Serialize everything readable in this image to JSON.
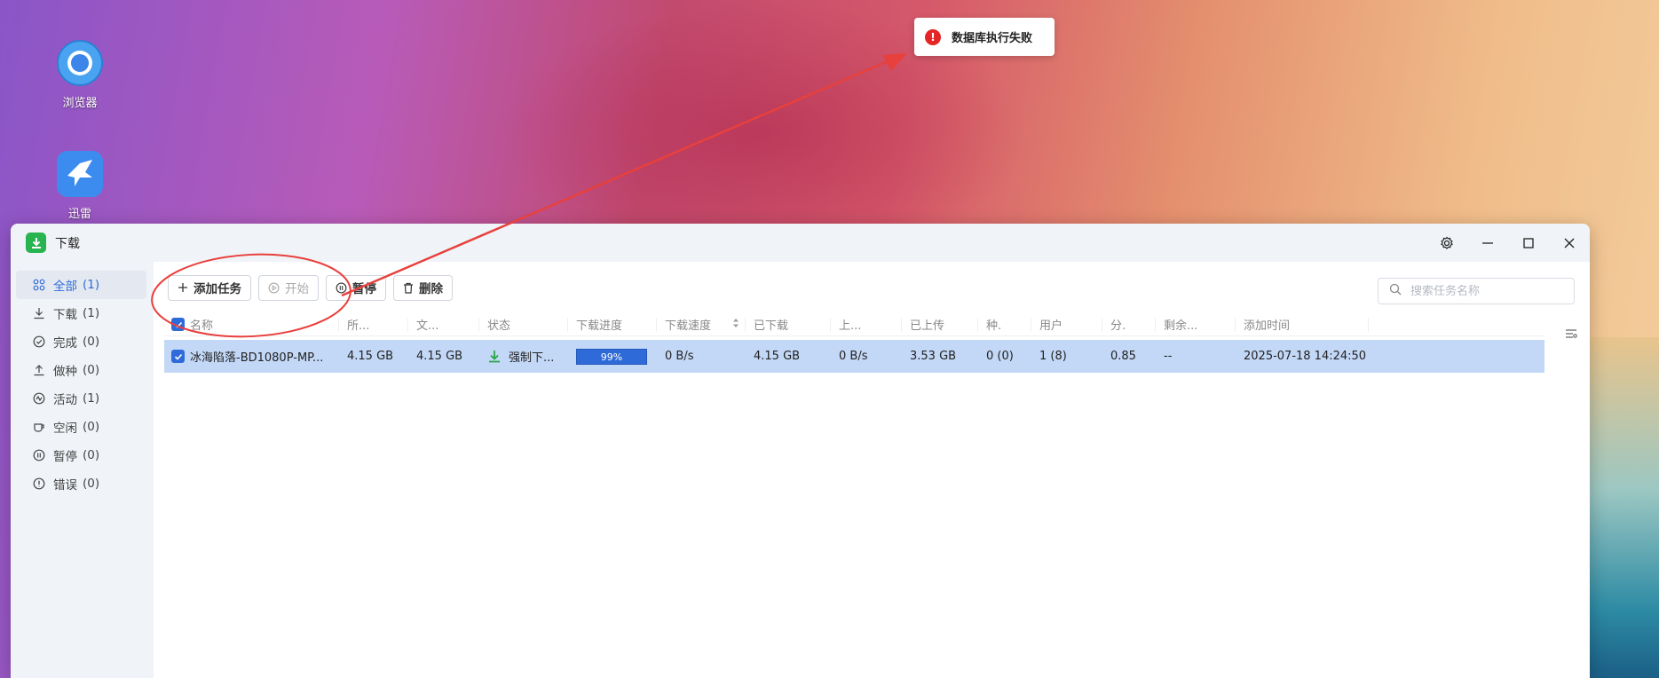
{
  "desktop": {
    "icons": [
      {
        "label": "浏览器",
        "icon": "chrome-icon"
      },
      {
        "label": "迅雷",
        "icon": "thunder-bird-icon"
      }
    ]
  },
  "toast": {
    "message": "数据库执行失败",
    "icon": "error-circle-icon",
    "color": "#e52626"
  },
  "window": {
    "title": "下载",
    "controls": [
      "gear-icon",
      "minimize-icon",
      "maximize-icon",
      "close-icon"
    ]
  },
  "sidebar": {
    "items": [
      {
        "label": "全部",
        "count": "(1)",
        "icon": "grid-icon",
        "active": true
      },
      {
        "label": "下载",
        "count": "(1)",
        "icon": "download-icon"
      },
      {
        "label": "完成",
        "count": "(0)",
        "icon": "check-circle-icon"
      },
      {
        "label": "做种",
        "count": "(0)",
        "icon": "upload-icon"
      },
      {
        "label": "活动",
        "count": "(1)",
        "icon": "activity-icon"
      },
      {
        "label": "空闲",
        "count": "(0)",
        "icon": "cup-icon"
      },
      {
        "label": "暂停",
        "count": "(0)",
        "icon": "pause-circle-icon"
      },
      {
        "label": "错误",
        "count": "(0)",
        "icon": "error-icon"
      }
    ]
  },
  "toolbar": {
    "add_label": "添加任务",
    "start_label": "开始",
    "pause_label": "暂停",
    "delete_label": "删除",
    "search_placeholder": "搜索任务名称"
  },
  "table": {
    "headers": [
      "名称",
      "所...",
      "文...",
      "状态",
      "下载进度",
      "下载速度",
      "已下载",
      "上...",
      "已上传",
      "种.",
      "用户",
      "分.",
      "剩余...",
      "添加时间"
    ],
    "rows": [
      {
        "name": "冰海陷落-BD1080P-MP...",
        "size": "4.15 GB",
        "file_size": "4.15 GB",
        "status": "强制下...",
        "progress_label": "99%",
        "progress": 0.99,
        "down_speed": "0 B/s",
        "downloaded": "4.15 GB",
        "up_speed": "0 B/s",
        "uploaded": "3.53 GB",
        "seeds": "0 (0)",
        "peers": "1 (8)",
        "ratio": "0.85",
        "remaining": "--",
        "added": "2025-07-18 14:24:50"
      }
    ]
  },
  "colors": {
    "accent": "#2f6bd8",
    "selected_row": "#c3d8f7",
    "annotation": "#e8403c"
  }
}
